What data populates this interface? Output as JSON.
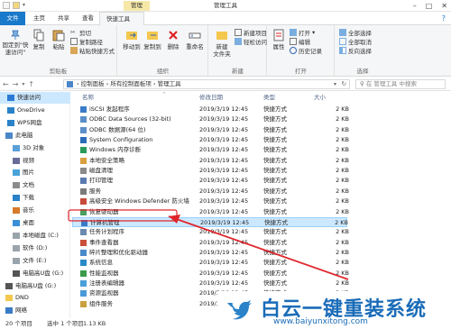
{
  "title_bar": {
    "context_tab": "管理",
    "title": "管理工具"
  },
  "tabs": [
    {
      "label": "文件"
    },
    {
      "label": "主页"
    },
    {
      "label": "共享"
    },
    {
      "label": "查看"
    },
    {
      "label": "快速工具"
    }
  ],
  "ribbon": {
    "clipboard": {
      "group": "剪贴板",
      "pin": "固定到\"快\n速访问\"",
      "copy": "复制",
      "paste": "粘贴",
      "cut": "剪切",
      "copy_path": "复制路径",
      "paste_shortcut": "粘贴快捷方式"
    },
    "organize": {
      "group": "组织",
      "move_to": "移动到",
      "copy_to": "复制到",
      "delete": "删除",
      "rename": "重命名"
    },
    "new": {
      "group": "新建",
      "new_folder": "新建\n文件夹",
      "new_item": "新建项目",
      "easy_access": "轻松访问"
    },
    "open": {
      "group": "打开",
      "properties": "属性",
      "open": "打开",
      "edit": "编辑",
      "history": "历史记录"
    },
    "select": {
      "group": "选择",
      "select_all": "全部选择",
      "select_none": "全部取消",
      "invert": "反向选择"
    }
  },
  "address": {
    "path": "› 控制面板 › 所有控制面板项 › 管理工具",
    "search_placeholder": "在 管理工具 中搜索"
  },
  "nav_pane": [
    {
      "label": "快速访问",
      "icon": "star-icon",
      "selected": true
    },
    {
      "label": "OneDrive",
      "icon": "cloud-icon"
    },
    {
      "label": "WPS网盘",
      "icon": "cloud-icon"
    },
    {
      "label": "此电脑",
      "icon": "computer-icon"
    },
    {
      "label": "3D 对象",
      "icon": "cube-icon"
    },
    {
      "label": "视频",
      "icon": "video-icon"
    },
    {
      "label": "图片",
      "icon": "picture-icon"
    },
    {
      "label": "文档",
      "icon": "document-icon"
    },
    {
      "label": "下载",
      "icon": "download-icon"
    },
    {
      "label": "音乐",
      "icon": "music-icon"
    },
    {
      "label": "桌面",
      "icon": "desktop-icon"
    },
    {
      "label": "本地磁盘 (C:)",
      "icon": "drive-icon"
    },
    {
      "label": "软件 (D:)",
      "icon": "drive-icon"
    },
    {
      "label": "文件 (E:)",
      "icon": "drive-icon"
    },
    {
      "label": "电脑高U盘 (G:)",
      "icon": "usb-icon"
    },
    {
      "label": "电脑高U盘 (G:)",
      "icon": "usb-icon"
    },
    {
      "label": "DND",
      "icon": "folder-icon"
    },
    {
      "label": "网络",
      "icon": "network-icon"
    }
  ],
  "columns": {
    "name": "名称",
    "date": "修改日期",
    "type": "类型",
    "size": "大小"
  },
  "files": [
    {
      "name": "iSCSI 发起程序",
      "date": "2019/3/19 12:45",
      "type": "快捷方式",
      "size": "2 KB"
    },
    {
      "name": "ODBC Data Sources (32-bit)",
      "date": "2019/3/19 12:45",
      "type": "快捷方式",
      "size": "2 KB"
    },
    {
      "name": "ODBC 数据源(64 位)",
      "date": "2019/3/19 12:45",
      "type": "快捷方式",
      "size": "2 KB"
    },
    {
      "name": "System Configuration",
      "date": "2019/3/19 12:45",
      "type": "快捷方式",
      "size": "2 KB"
    },
    {
      "name": "Windows 内存诊断",
      "date": "2019/3/19 12:45",
      "type": "快捷方式",
      "size": "2 KB"
    },
    {
      "name": "本地安全策略",
      "date": "2019/3/19 12:45",
      "type": "快捷方式",
      "size": "2 KB"
    },
    {
      "name": "磁盘清理",
      "date": "2019/3/19 12:45",
      "type": "快捷方式",
      "size": "2 KB"
    },
    {
      "name": "打印管理",
      "date": "2019/3/19 12:45",
      "type": "快捷方式",
      "size": "2 KB"
    },
    {
      "name": "服务",
      "date": "2019/3/19 12:45",
      "type": "快捷方式",
      "size": "2 KB"
    },
    {
      "name": "高级安全 Windows Defender 防火墙",
      "date": "2019/3/19 12:45",
      "type": "快捷方式",
      "size": "2 KB"
    },
    {
      "name": "恢复驱动器",
      "date": "2019/3/19 12:45",
      "type": "快捷方式",
      "size": "2 KB"
    },
    {
      "name": "计算机管理",
      "date": "2019/3/19 12:45",
      "type": "快捷方式",
      "size": "2 KB",
      "selected": true
    },
    {
      "name": "任务计划程序",
      "date": "2019/3/19 12:45",
      "type": "快捷方式",
      "size": "2 KB"
    },
    {
      "name": "事件查看器",
      "date": "2019/3/19 12:45",
      "type": "快捷方式",
      "size": "2 KB"
    },
    {
      "name": "碎片整理和优化驱动器",
      "date": "2019/3/19 12:45",
      "type": "快捷方式",
      "size": "2 KB"
    },
    {
      "name": "系统信息",
      "date": "2019/3/19 12:45",
      "type": "快捷方式",
      "size": "2 KB"
    },
    {
      "name": "性能监视器",
      "date": "2019/3/19 12:45",
      "type": "快捷方式",
      "size": "2 KB"
    },
    {
      "name": "注册表编辑器",
      "date": "2019/3/19 12:45",
      "type": "快捷方式",
      "size": "2 KB"
    },
    {
      "name": "资源监视器",
      "date": "2019/3/19 12:45",
      "type": "快捷方式",
      "size": "2 KB"
    },
    {
      "name": "组件服务",
      "date": "2019/3/19 12:45",
      "type": "快捷方式",
      "size": "2 KB"
    }
  ],
  "status_bar": {
    "count": "20 个项目",
    "selected": "选中 1 个项目",
    "size": "1.13 KB"
  },
  "watermark": {
    "brand": "白云一键重装系统",
    "url": "www.baiyunxitong.com"
  },
  "colors": {
    "accent": "#1979ca",
    "context_tab": "#f6e9a8",
    "selection": "#cce8ff",
    "annotation": "#e0252b"
  }
}
